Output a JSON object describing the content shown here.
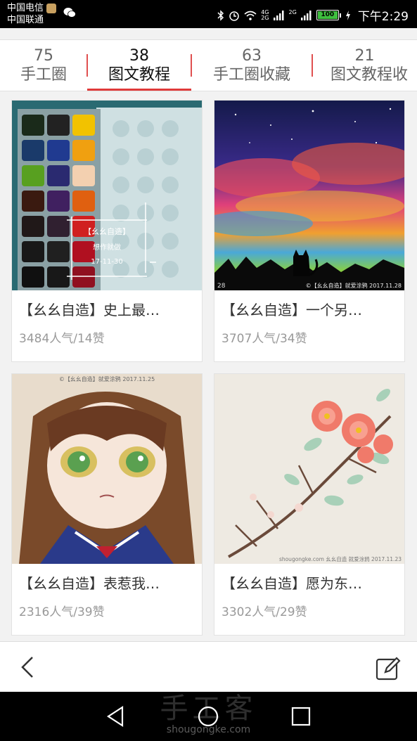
{
  "status_bar": {
    "carrier1": "中国电信",
    "carrier2": "中国联通",
    "net1": "4G",
    "net2": "2G",
    "net3": "2G",
    "battery": "100",
    "time": "下午2:29"
  },
  "tabs": [
    {
      "count": "75",
      "label": "手工圈"
    },
    {
      "count": "38",
      "label": "图文教程"
    },
    {
      "count": "63",
      "label": "手工圈收藏"
    },
    {
      "count": "21",
      "label": "图文教程收"
    }
  ],
  "active_tab": 1,
  "cards": [
    {
      "title": "【幺幺自造】史上最…",
      "stats": "3484人气/14赞",
      "thumb": "paint-palette",
      "overlay": {
        "brand": "【幺幺自造】",
        "slogan": "想作就做",
        "date": "17-11-30"
      }
    },
    {
      "title": "【幺幺自造】一个另…",
      "stats": "3707人气/34赞",
      "thumb": "galaxy-cat",
      "caption": "©【幺幺自造】就爱涂鸦 2017.11.28",
      "corner": "28"
    },
    {
      "title": "【幺幺自造】表惹我…",
      "stats": "2316人气/39赞",
      "thumb": "anime-girl",
      "caption": "©【幺幺自造】就爱涂鸦 2017.11.25"
    },
    {
      "title": "【幺幺自造】愿为东…",
      "stats": "3302人气/29赞",
      "thumb": "flower-branch",
      "caption": "shougongke.com 幺幺自造 就爱涂鸦 2017.11.23"
    }
  ],
  "bottom_bar": {
    "back": "back-icon",
    "edit": "edit-icon"
  },
  "watermark": {
    "main": "手工客",
    "sub": "shougongke.com"
  },
  "colors": {
    "accent": "#e03a3a",
    "text": "#333333",
    "muted": "#999999"
  }
}
